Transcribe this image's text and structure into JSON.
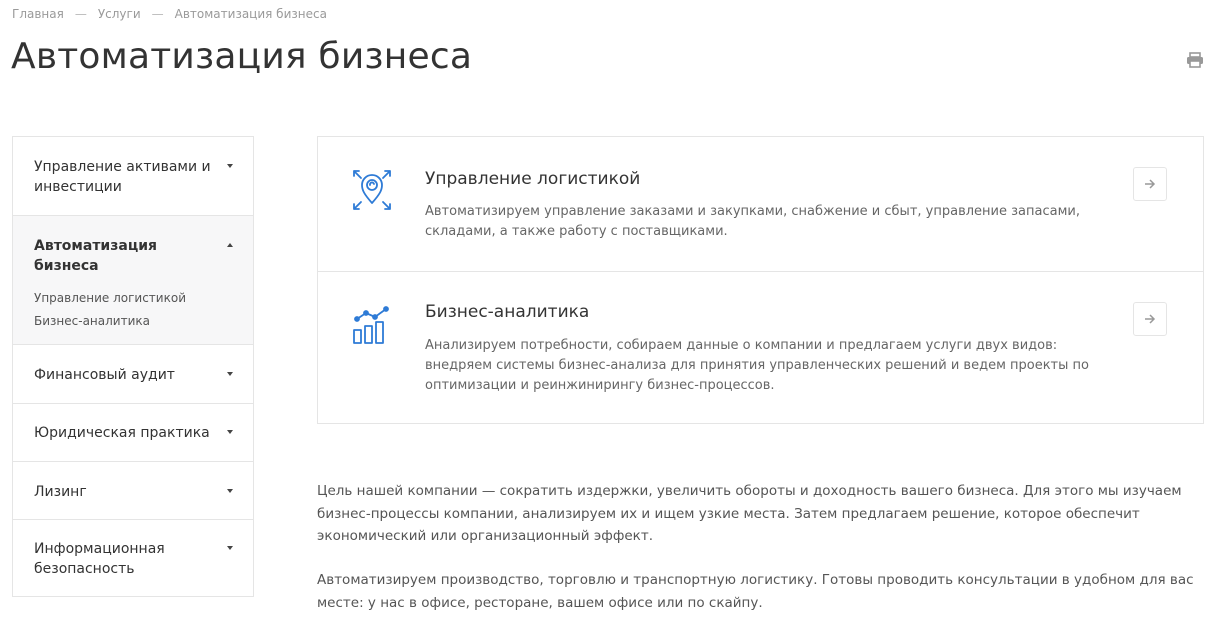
{
  "breadcrumb": {
    "items": [
      "Главная",
      "Услуги",
      "Автоматизация бизнеса"
    ],
    "separator": "—"
  },
  "page": {
    "title": "Автоматизация бизнеса",
    "print_icon": "printer-icon"
  },
  "sidebar": {
    "items": [
      {
        "label": "Управление активами и инвестиции",
        "icon": "chevron-down-icon"
      },
      {
        "label": "Автоматизация бизнеса",
        "icon": "chevron-up-icon",
        "active": true,
        "subitems": [
          "Управление логистикой",
          "Бизнес-аналитика"
        ]
      },
      {
        "label": "Финансовый аудит",
        "icon": "chevron-down-icon"
      },
      {
        "label": "Юридическая практика",
        "icon": "chevron-down-icon"
      },
      {
        "label": "Лизинг",
        "icon": "chevron-down-icon"
      },
      {
        "label": "Информационная безопасность",
        "icon": "chevron-down-icon"
      }
    ]
  },
  "cards": [
    {
      "title": "Управление логистикой",
      "description": "Автоматизируем управление заказами и закупками, снабжение и сбыт, управление запасами, складами, а также работу с поставщиками.",
      "icon": "location-pin-arrows-icon"
    },
    {
      "title": "Бизнес-аналитика",
      "description": "Анализируем потребности, собираем данные о компании и предлагаем услуги двух видов: внедряем системы бизнес-анализа для принятия управленческих решений и ведем проекты по оптимизации и реинжинирингу бизнес-процессов.",
      "icon": "bar-chart-trend-icon"
    }
  ],
  "content": {
    "paragraphs": [
      "Цель нашей компании — сократить издержки, увеличить обороты и доходность вашего бизнеса. Для этого мы изучаем бизнес-процессы компании, анализируем их и ищем узкие места. Затем предлагаем решение, которое обеспечит экономический или организационный эффект.",
      "Автоматизируем производство, торговлю и транспортную логистику. Готовы проводить консультации в удобном для вас месте: у нас в офисе, ресторане, вашем офисе или по скайпу."
    ]
  },
  "colors": {
    "accent": "#2e7bd6",
    "border": "#e5e5e5",
    "active_bg": "#f7f7f8",
    "title": "#333333",
    "muted": "#9a9a9a"
  }
}
